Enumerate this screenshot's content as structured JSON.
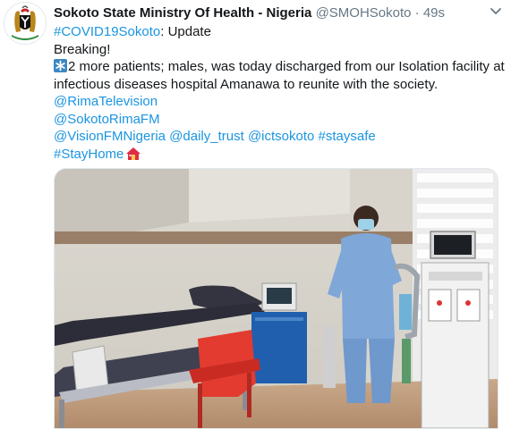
{
  "tweet": {
    "author_name": "Sokoto State Ministry Of Health - Nigeria",
    "handle": "@SMOHSokoto",
    "separator": "·",
    "time": "49s",
    "hashtag_covid": "#COVID19Sokoto",
    "update_suffix": ": Update",
    "breaking": "Breaking!",
    "body_line1": "2 more patients; males, was today discharged from our Isolation facility at",
    "body_line2": "infectious diseases hospital Amanawa to reunite with the society.",
    "mention_rima_tv": "@RimaTelevision",
    "mention_sokoto_fm": "@SokotoRimaFM",
    "mention_vision_fm": "@VisionFMNigeria",
    "mention_daily_trust": "@daily_trust",
    "mention_ict": "@ictsokoto",
    "hashtag_staysafe": "#staysafe",
    "hashtag_stayhome": "#StayHome"
  },
  "icons": {
    "avatar": "nigeria-coat-of-arms",
    "caret": "chevron-down-icon",
    "asterisk_emoji": "eight-spoked-asterisk-icon",
    "house_emoji": "house-icon"
  },
  "colors": {
    "link": "#1b95e0",
    "secondary_text": "#657786",
    "primary_text": "#14171a"
  }
}
